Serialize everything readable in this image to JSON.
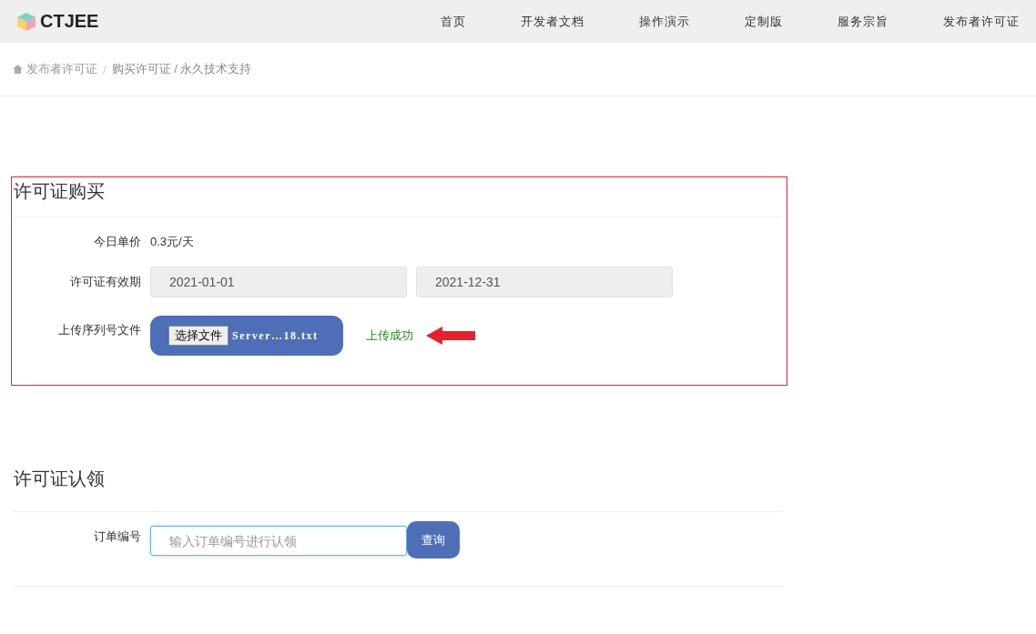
{
  "brand": {
    "name": "CTJEE"
  },
  "nav": [
    {
      "label": "首页"
    },
    {
      "label": "开发者文档"
    },
    {
      "label": "操作演示"
    },
    {
      "label": "定制版"
    },
    {
      "label": "服务宗旨"
    },
    {
      "label": "发布者许可证"
    }
  ],
  "breadcrumb": [
    {
      "label": "发布者许可证"
    },
    {
      "label": "购买许可证 / 永久技术支持"
    }
  ],
  "breadcrumb_separator": "/",
  "purchase": {
    "title": "许可证购买",
    "highlighted": true,
    "rows": [
      {
        "kind": "text",
        "label": "今日单价",
        "value": "0.3元/天"
      },
      {
        "kind": "dates",
        "label": "许可证有效期",
        "start": "2021-01-01",
        "end": "2021-12-31"
      },
      {
        "kind": "file",
        "label": "上传序列号文件",
        "button": "选择文件",
        "file": "Server…18.txt",
        "status": "上传成功",
        "arrow": true
      }
    ]
  },
  "claim": {
    "title": "许可证认领",
    "label": "订单编号",
    "placeholder": "输入订单编号进行认领",
    "button": "查询"
  }
}
